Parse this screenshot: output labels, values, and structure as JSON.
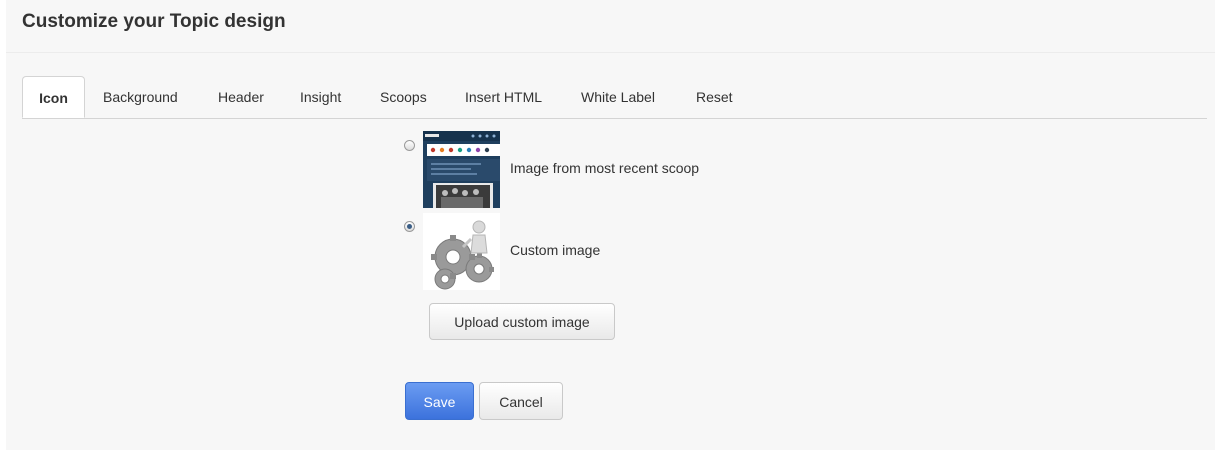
{
  "page": {
    "title": "Customize your Topic design"
  },
  "tabs": [
    {
      "label": "Icon",
      "active": true
    },
    {
      "label": "Background",
      "active": false
    },
    {
      "label": "Header",
      "active": false
    },
    {
      "label": "Insight",
      "active": false
    },
    {
      "label": "Scoops",
      "active": false
    },
    {
      "label": "Insert HTML",
      "active": false
    },
    {
      "label": "White Label",
      "active": false
    },
    {
      "label": "Reset",
      "active": false
    }
  ],
  "icon_options": {
    "recent_scoop": {
      "label": "Image from most recent scoop",
      "selected": false,
      "thumbnail": "scoop-screenshot-thumbnail"
    },
    "custom": {
      "label": "Custom image",
      "selected": true,
      "thumbnail": "gears-figure-thumbnail"
    }
  },
  "buttons": {
    "upload": "Upload custom image",
    "save": "Save",
    "cancel": "Cancel"
  },
  "colors": {
    "panel_bg": "#f7f7f7",
    "primary_button": "#4a7fe3",
    "text": "#333333"
  }
}
